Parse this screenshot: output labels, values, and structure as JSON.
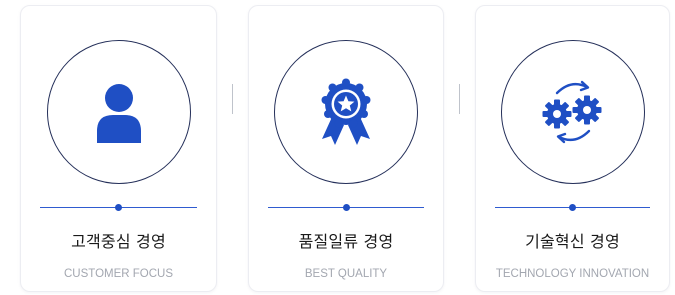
{
  "colors": {
    "accent": "#1f4fc4",
    "ring": "#25305a",
    "title": "#1a1a1a",
    "subtitle": "#a3a7b0"
  },
  "cards": [
    {
      "icon": "person-icon",
      "title": "고객중심 경영",
      "subtitle": "CUSTOMER FOCUS"
    },
    {
      "icon": "award-ribbon-icon",
      "title": "품질일류 경영",
      "subtitle": "BEST QUALITY"
    },
    {
      "icon": "gears-cycle-icon",
      "title": "기술혁신 경영",
      "subtitle": "TECHNOLOGY INNOVATION"
    }
  ]
}
